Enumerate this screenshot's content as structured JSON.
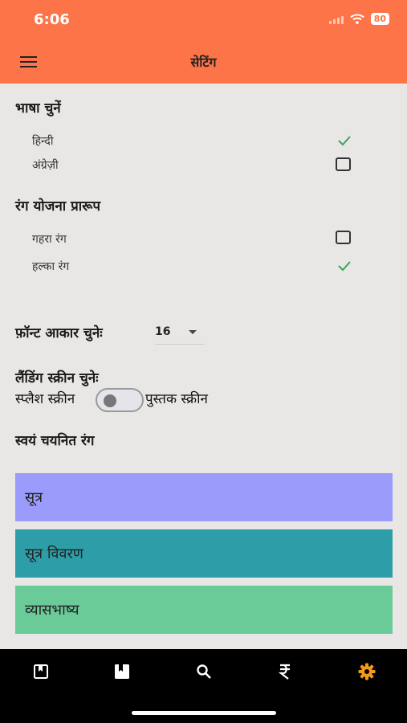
{
  "status_bar": {
    "time": "6:06",
    "battery": "80"
  },
  "header": {
    "title": "सेटिंग"
  },
  "language": {
    "heading": "भाषा चुनें",
    "options": [
      {
        "label": "हिन्दी",
        "selected": true
      },
      {
        "label": "अंग्रेज़ी",
        "selected": false
      }
    ]
  },
  "theme": {
    "heading": "रंग योजना प्रारूप",
    "options": [
      {
        "label": "गहरा रंग",
        "selected": false
      },
      {
        "label": "हल्का रंग",
        "selected": true
      }
    ]
  },
  "font_size": {
    "label": "फ़ॉन्ट आकार चुनेः",
    "value": "16"
  },
  "landing": {
    "heading": "लैंडिंग स्क्रीन चुनेः",
    "left_label": "स्प्लैश स्क्रीन",
    "right_label": "पुस्तक स्क्रीन",
    "toggle_on": false
  },
  "custom_colors": {
    "heading": "स्वयं चयनित रंग",
    "items": [
      {
        "label": "सूत्र",
        "color": "#9a9bfa"
      },
      {
        "label": "सूत्र विवरण",
        "color": "#2d9ea7"
      },
      {
        "label": "व्यासभाष्य",
        "color": "#6acb98"
      }
    ]
  },
  "bottom_nav": {
    "items": [
      {
        "icon": "book-outline-icon",
        "color": "#ffffff"
      },
      {
        "icon": "book-filled-icon",
        "color": "#ffffff"
      },
      {
        "icon": "search-icon",
        "color": "#ffffff"
      },
      {
        "icon": "rupee-icon",
        "color": "#ffffff"
      },
      {
        "icon": "settings-gear-icon",
        "color": "#f39a1a"
      }
    ],
    "active_index": 4
  },
  "colors": {
    "header": "#fd7448",
    "background": "#e9e7e5",
    "check": "#3aa55c"
  }
}
